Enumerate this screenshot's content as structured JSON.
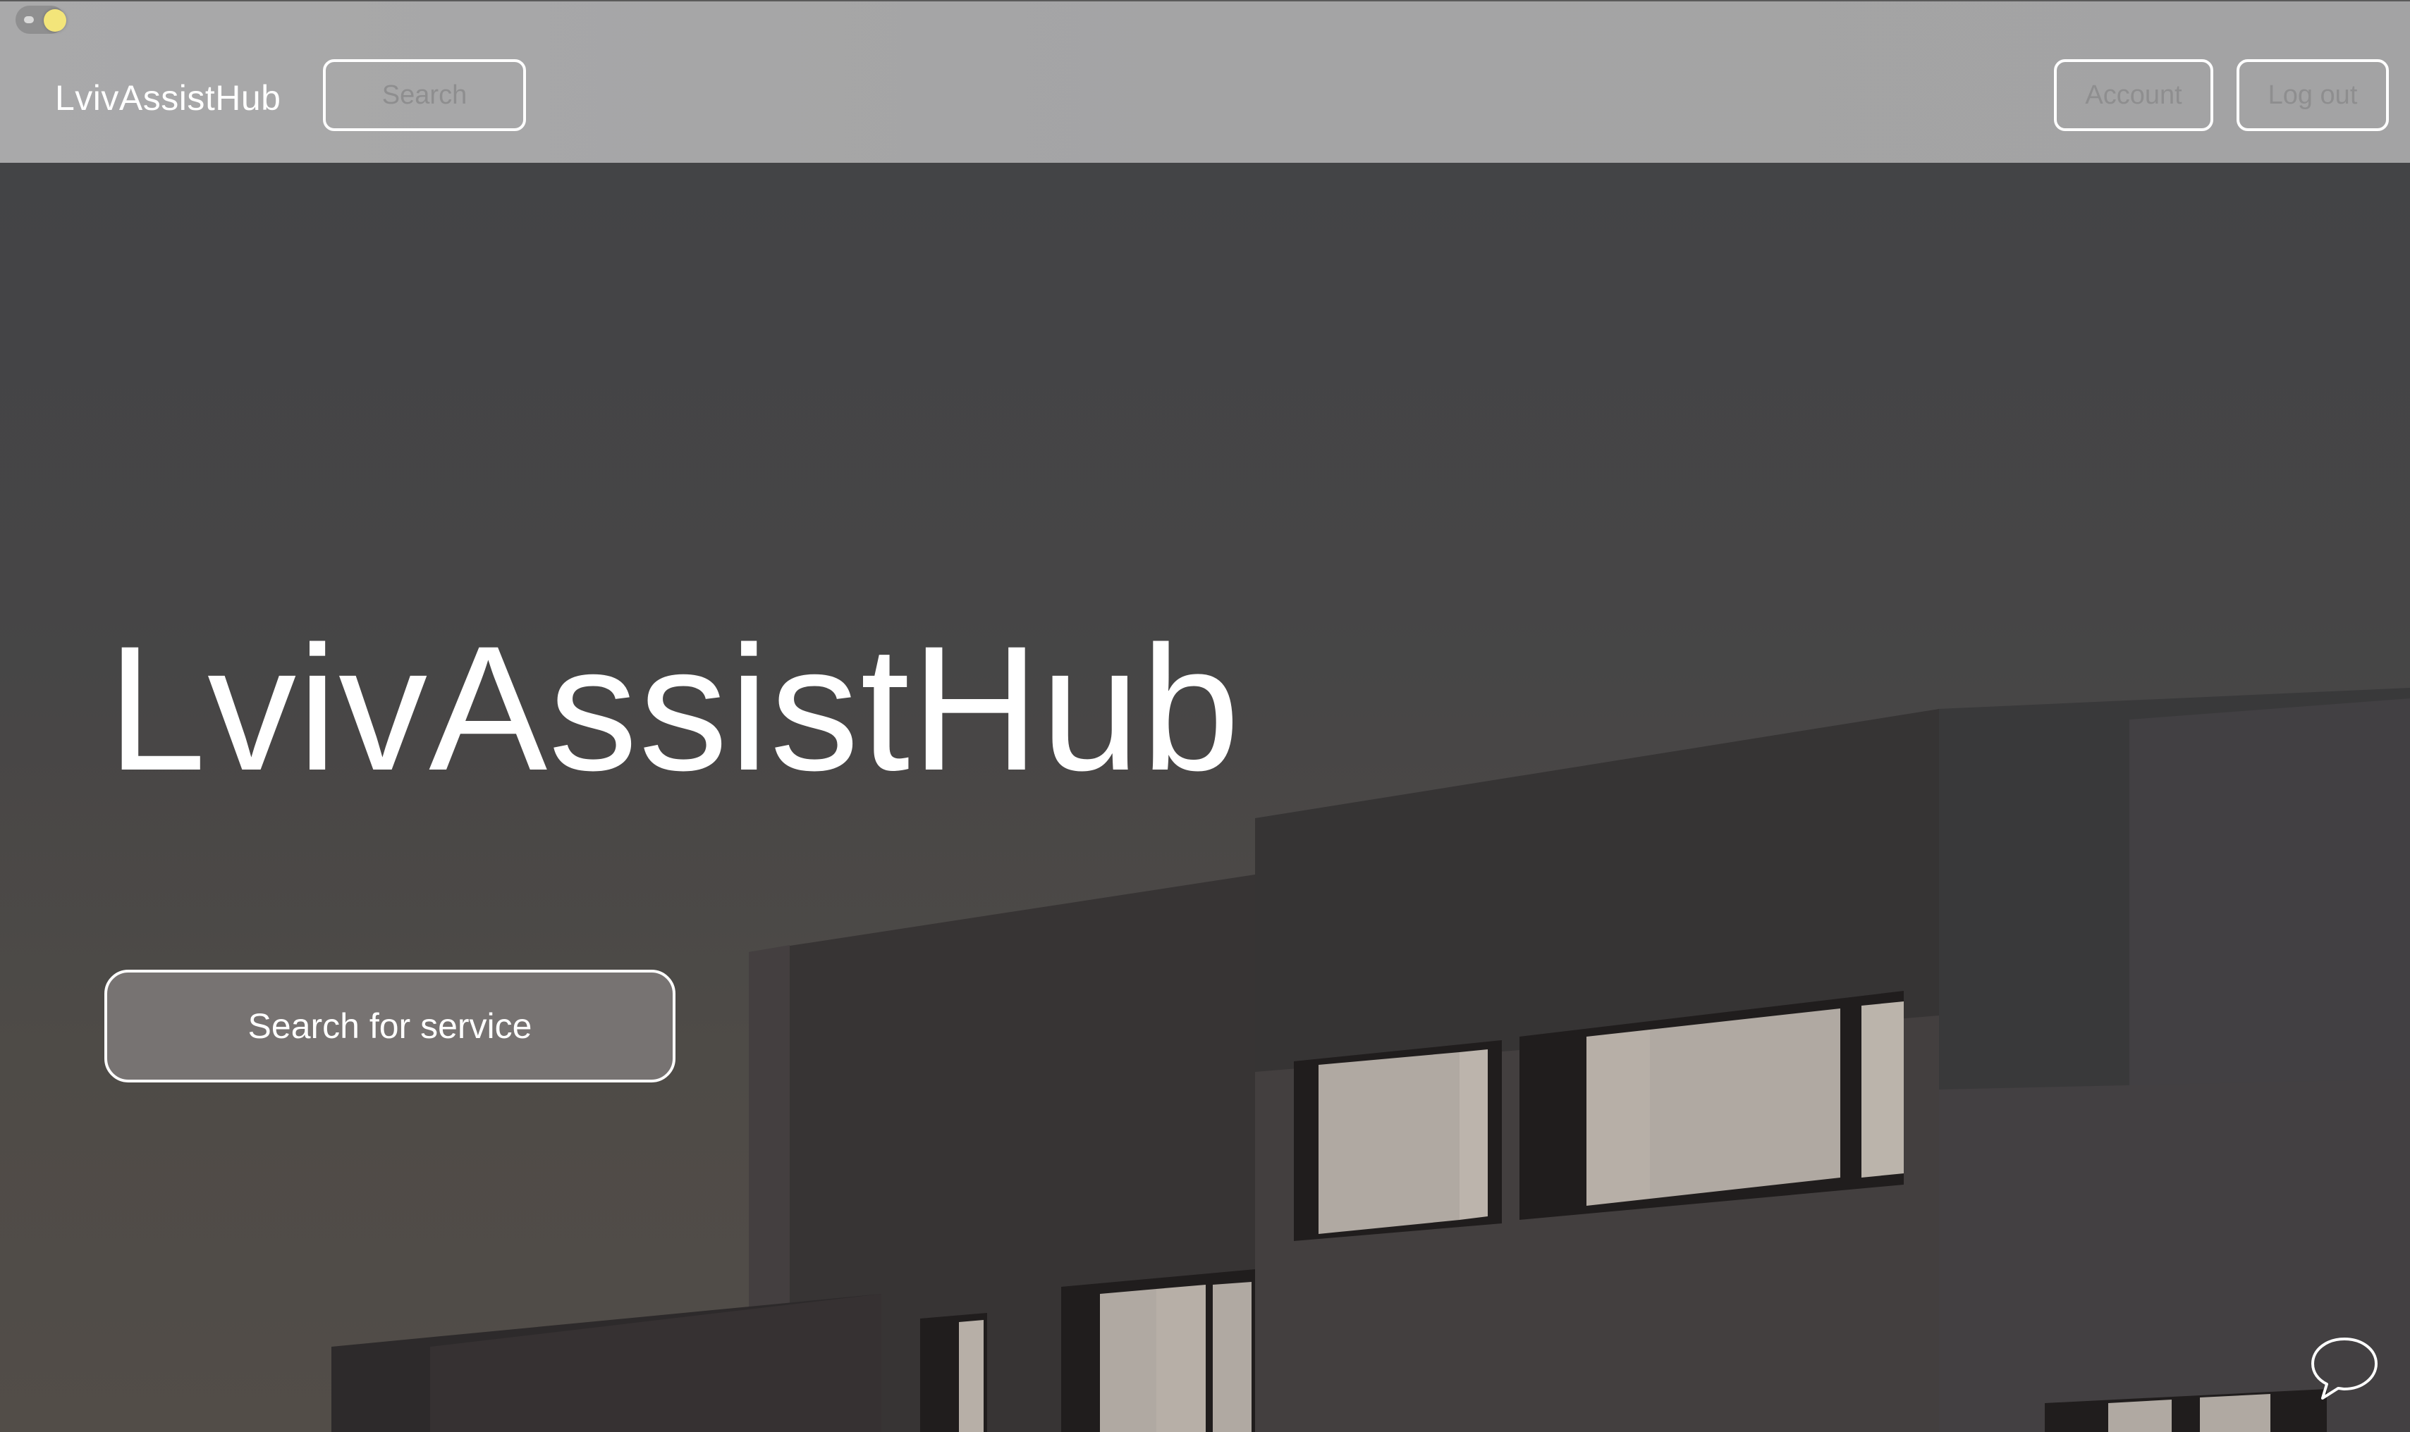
{
  "header": {
    "brand": "LvivAssistHub",
    "search_label": "Search",
    "account_label": "Account",
    "logout_label": "Log out",
    "theme_toggle_icon": "sun-toggle-icon"
  },
  "hero": {
    "title": "LvivAssistHub",
    "cta_label": "Search for service",
    "background": "building-photo"
  },
  "chat": {
    "icon": "chat-bubble-icon"
  },
  "colors": {
    "header_bg": "#a9a9aa",
    "button_border": "#ffffff",
    "button_text": "#8e8e8f",
    "toggle_knob": "#f3e57a",
    "cta_bg": "#7d7979"
  }
}
